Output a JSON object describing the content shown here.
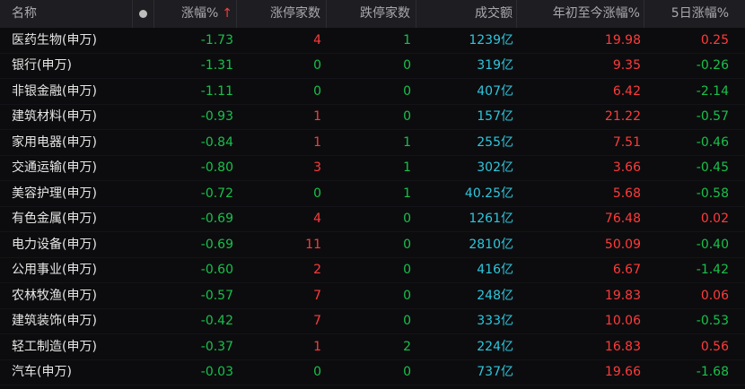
{
  "header": {
    "name": "名称",
    "change_pct": "涨幅%",
    "sort_arrow": "↑",
    "limit_up": "涨停家数",
    "limit_down": "跌停家数",
    "turnover": "成交额",
    "ytd_change": "年初至今涨幅%",
    "five_day": "5日涨幅%"
  },
  "colors": {
    "background": "#0c0c0e",
    "header_bg": "#1e1e22",
    "up_red": "#ff3b3b",
    "down_green": "#19c04b",
    "turnover_cyan": "#2fc6dd"
  },
  "icons": {
    "header_dot": "dot-icon"
  },
  "rows": [
    {
      "name": "医药生物(申万)",
      "change": "-1.73",
      "up": "4",
      "down": "1",
      "turnover": "1239亿",
      "ytd": "19.98",
      "five_day": "0.25"
    },
    {
      "name": "银行(申万)",
      "change": "-1.31",
      "up": "0",
      "down": "0",
      "turnover": "319亿",
      "ytd": "9.35",
      "five_day": "-0.26"
    },
    {
      "name": "非银金融(申万)",
      "change": "-1.11",
      "up": "0",
      "down": "0",
      "turnover": "407亿",
      "ytd": "6.42",
      "five_day": "-2.14"
    },
    {
      "name": "建筑材料(申万)",
      "change": "-0.93",
      "up": "1",
      "down": "0",
      "turnover": "157亿",
      "ytd": "21.22",
      "five_day": "-0.57"
    },
    {
      "name": "家用电器(申万)",
      "change": "-0.84",
      "up": "1",
      "down": "1",
      "turnover": "255亿",
      "ytd": "7.51",
      "five_day": "-0.46"
    },
    {
      "name": "交通运输(申万)",
      "change": "-0.80",
      "up": "3",
      "down": "1",
      "turnover": "302亿",
      "ytd": "3.66",
      "five_day": "-0.45"
    },
    {
      "name": "美容护理(申万)",
      "change": "-0.72",
      "up": "0",
      "down": "1",
      "turnover": "40.25亿",
      "ytd": "5.68",
      "five_day": "-0.58"
    },
    {
      "name": "有色金属(申万)",
      "change": "-0.69",
      "up": "4",
      "down": "0",
      "turnover": "1261亿",
      "ytd": "76.48",
      "five_day": "0.02"
    },
    {
      "name": "电力设备(申万)",
      "change": "-0.69",
      "up": "11",
      "down": "0",
      "turnover": "2810亿",
      "ytd": "50.09",
      "five_day": "-0.40"
    },
    {
      "name": "公用事业(申万)",
      "change": "-0.60",
      "up": "2",
      "down": "0",
      "turnover": "416亿",
      "ytd": "6.67",
      "five_day": "-1.42"
    },
    {
      "name": "农林牧渔(申万)",
      "change": "-0.57",
      "up": "7",
      "down": "0",
      "turnover": "248亿",
      "ytd": "19.83",
      "five_day": "0.06"
    },
    {
      "name": "建筑装饰(申万)",
      "change": "-0.42",
      "up": "7",
      "down": "0",
      "turnover": "333亿",
      "ytd": "10.06",
      "five_day": "-0.53"
    },
    {
      "name": "轻工制造(申万)",
      "change": "-0.37",
      "up": "1",
      "down": "2",
      "turnover": "224亿",
      "ytd": "16.83",
      "five_day": "0.56"
    },
    {
      "name": "汽车(申万)",
      "change": "-0.03",
      "up": "0",
      "down": "0",
      "turnover": "737亿",
      "ytd": "19.66",
      "five_day": "-1.68"
    }
  ]
}
